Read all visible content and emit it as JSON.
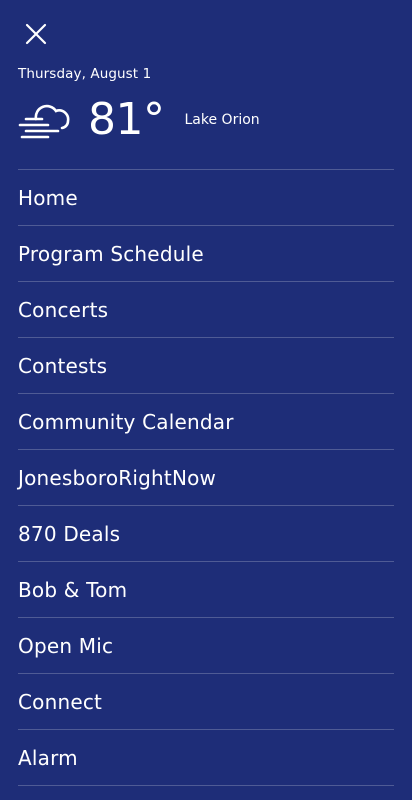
{
  "header": {
    "close_icon": "close-icon"
  },
  "weather": {
    "date": "Thursday, August 1",
    "icon": "fog-cloud-icon",
    "temperature": "81°",
    "location": "Lake Orion"
  },
  "menu": {
    "items": [
      {
        "label": "Home"
      },
      {
        "label": "Program Schedule"
      },
      {
        "label": "Concerts"
      },
      {
        "label": "Contests"
      },
      {
        "label": "Community Calendar"
      },
      {
        "label": "JonesboroRightNow"
      },
      {
        "label": "870 Deals"
      },
      {
        "label": "Bob & Tom"
      },
      {
        "label": "Open Mic"
      },
      {
        "label": "Connect"
      },
      {
        "label": "Alarm"
      }
    ]
  },
  "colors": {
    "background": "#1e2d78",
    "text": "#ffffff"
  }
}
